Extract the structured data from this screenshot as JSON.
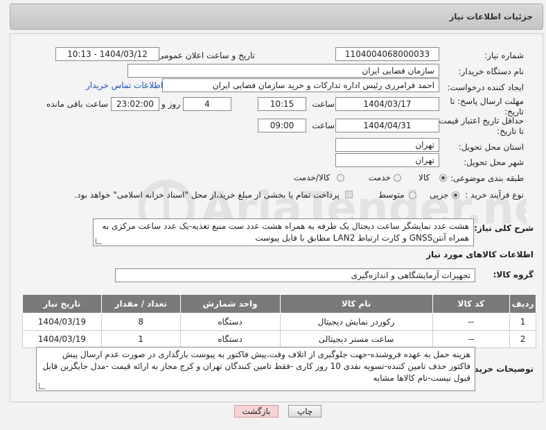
{
  "header": {
    "title": "جزئیات اطلاعات نیاز"
  },
  "form": {
    "need_number_label": "شماره نیاز:",
    "need_number": "1104004068000033",
    "announce_label": "تاریخ و ساعت اعلان عمومی:",
    "announce_value": "1404/03/12 - 10:13",
    "buyer_org_label": "نام دستگاه خریدار:",
    "buyer_org": "سازمان فضایی ایران",
    "requester_label": "ایجاد کننده درخواست:",
    "requester": "احمد فرامرزی رئیس اداره تدارکات و خرید سازمان فضایی ایران",
    "contact_link": "اطلاعات تماس خریدار",
    "deadline_label": "مهلت ارسال پاسخ: تا تاریخ:",
    "deadline_date": "1404/03/17",
    "time_label": "ساعت",
    "deadline_time": "10:15",
    "days_value": "4",
    "days_label": "روز و",
    "remaining_time": "23:02:00",
    "remaining_label": "ساعت باقی مانده",
    "validity_label": "حداقل تاریخ اعتبار قیمت: تا تاریخ:",
    "validity_date": "1404/04/31",
    "validity_time": "09:00",
    "province_label": "استان محل تحویل:",
    "province": "تهران",
    "city_label": "شهر محل تحویل:",
    "city": "تهران",
    "category_label": "طبقه بندی موضوعی:",
    "category_options": [
      "کالا",
      "خدمت",
      "کالا/خدمت"
    ],
    "process_label": "نوع فرآیند خرید :",
    "process_options": [
      "جزیی",
      "متوسط"
    ],
    "payment_note": "پرداخت تمام یا بخشی از مبلغ خرید،از محل \"اسناد خزانه اسلامی\" خواهد بود."
  },
  "description": {
    "label": "شرح کلی نیاز:",
    "text": "هشت عدد نمایشگر ساعت دیجتال یک طرفه به همراه هشت عدد ست منبع تغذیه-یک عدد ساعت مرکزی به همراه آنتنGNSS و کارت ارتباط LAN2 مطابق با فایل پیوست"
  },
  "goods": {
    "section_title": "اطلاعات کالاهای مورد نیاز",
    "group_label": "گروه کالا:",
    "group_value": "تجهیزات آزمایشگاهی و اندازه‌گیری",
    "columns": [
      "ردیف",
      "کد کالا",
      "نام کالا",
      "واحد شمارش",
      "تعداد / مقدار",
      "تاریخ نیاز"
    ],
    "rows": [
      {
        "row": "1",
        "code": "--",
        "name": "رکوردر نمایش دیجیتال",
        "unit": "دستگاه",
        "qty": "8",
        "date": "1404/03/19"
      },
      {
        "row": "2",
        "code": "--",
        "name": "ساعت مستر دیجیتالی",
        "unit": "دستگاه",
        "qty": "1",
        "date": "1404/03/19"
      }
    ]
  },
  "buyer_notes": {
    "label": "توضیحات خریدار:",
    "text": "هزینه حمل به عهده فروشنده-جهت جلوگیری از اتلاف وقت،پیش فاکتور به پیوست بارگذاری در صورت عدم ارسال پیش فاکتور حذف تامین کننده-تسویه نقدی 10 روز کاری -فقط تامین کنندگان تهران و کرج مجاز به ارائه قیمت -مدل جایگزین قابل قبول نیست-نام کالاها مشابه"
  },
  "buttons": {
    "print": "چاپ",
    "back": "بازگشت"
  },
  "watermark": {
    "text": "AriaTender.neT"
  }
}
